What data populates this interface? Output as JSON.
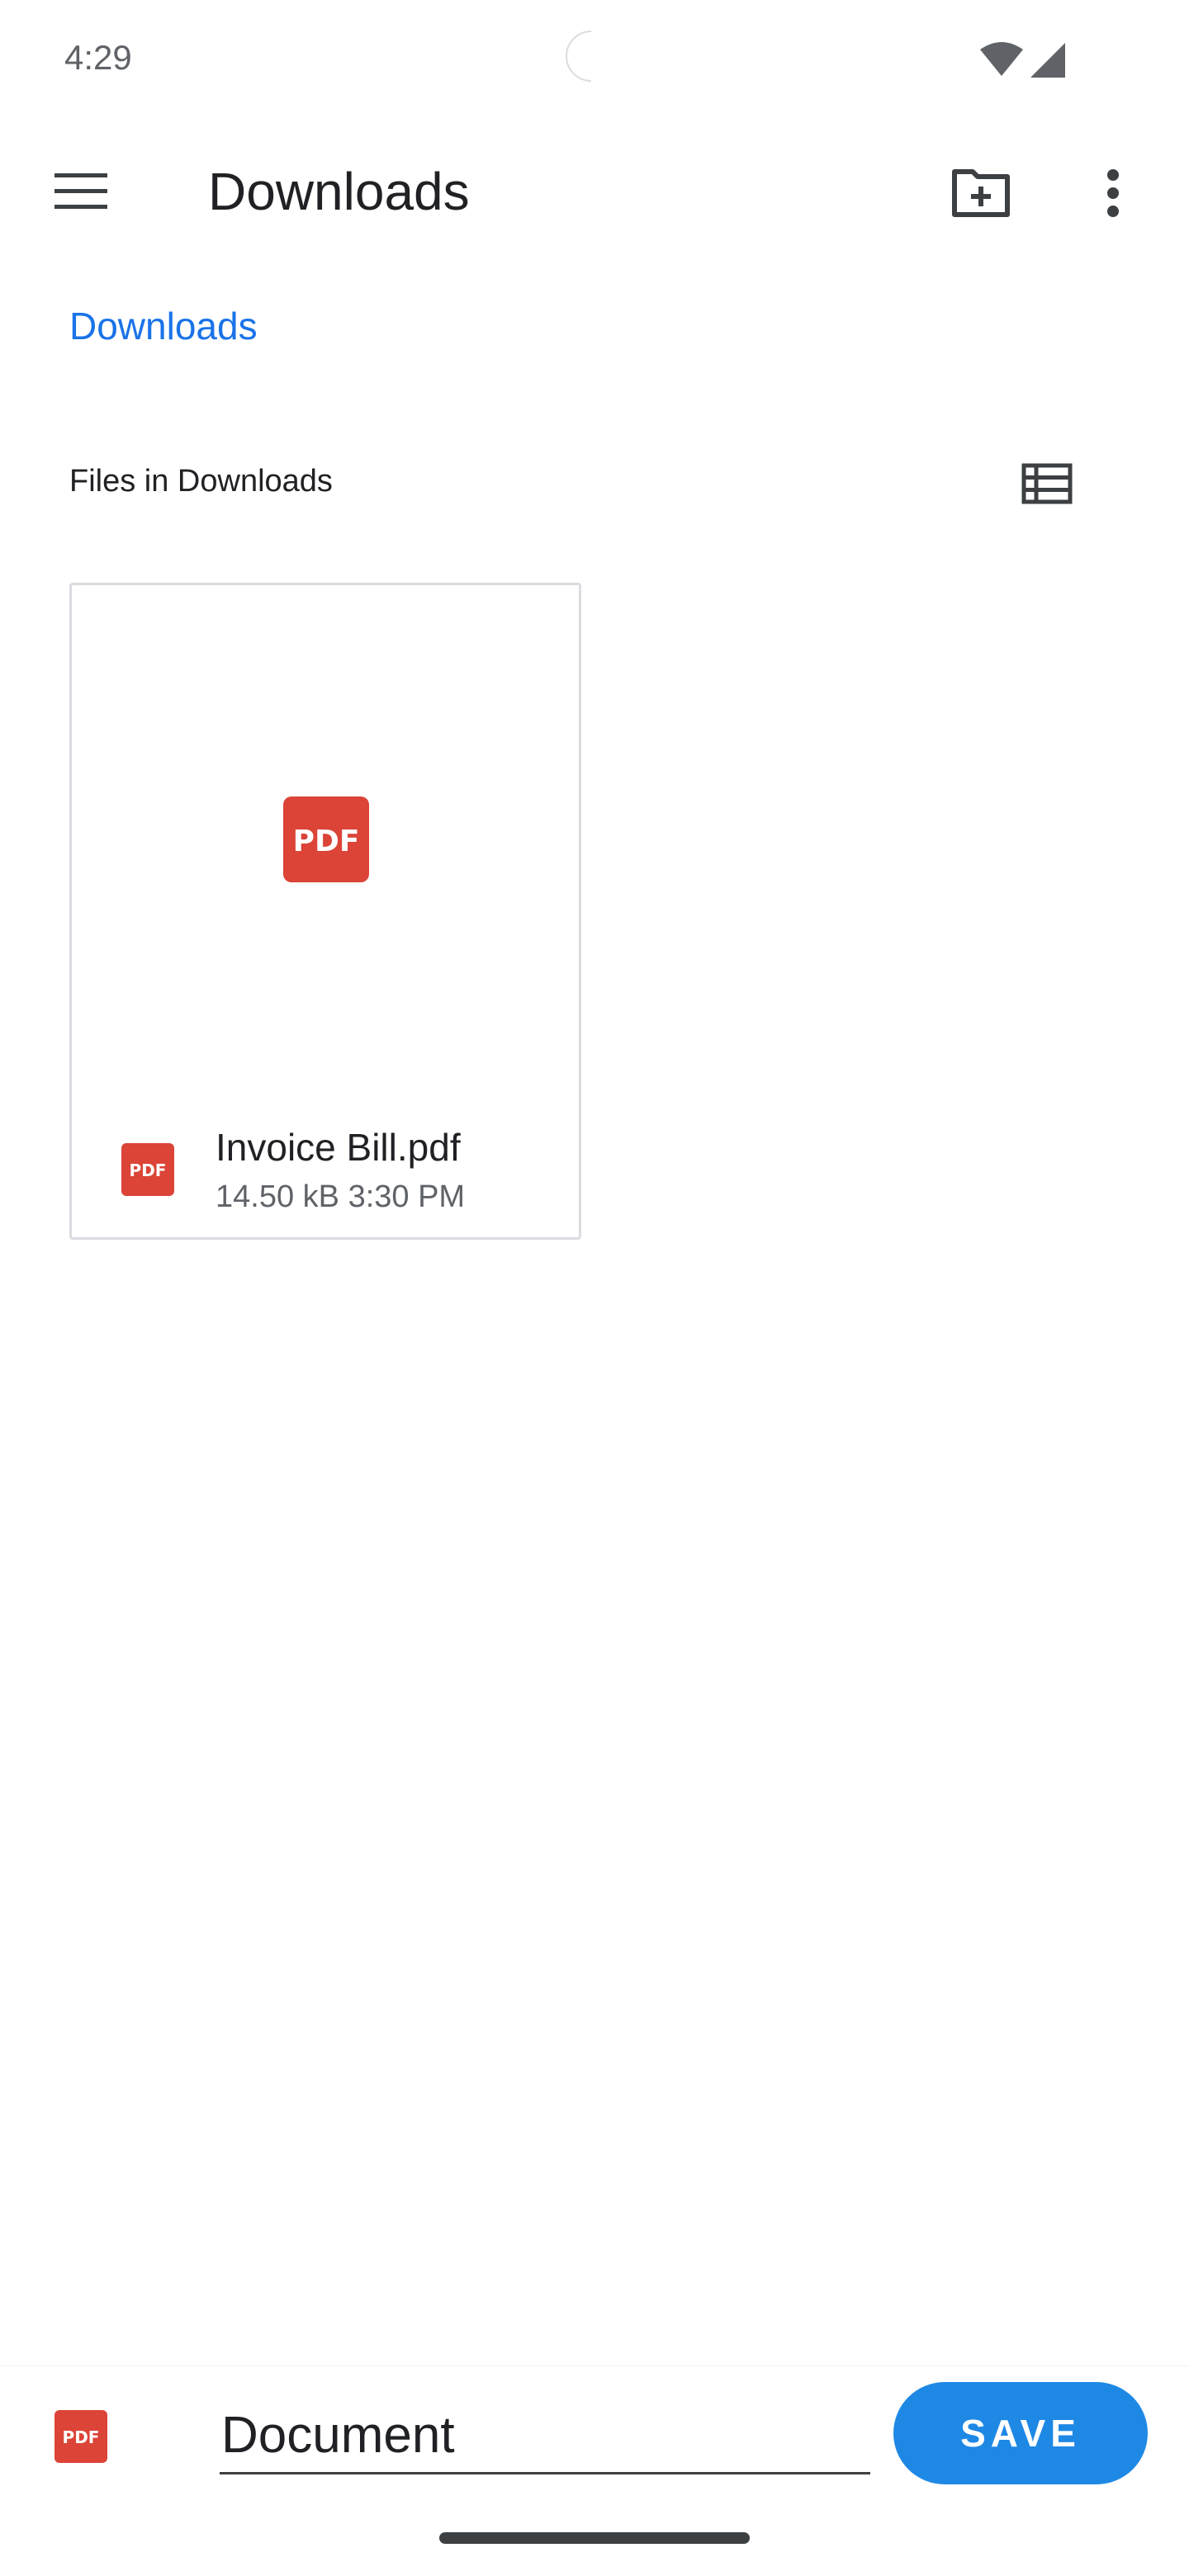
{
  "status_bar": {
    "time": "4:29",
    "icons": [
      "camera-cutout",
      "wifi-icon",
      "cellular-signal-icon"
    ]
  },
  "toolbar": {
    "title": "Downloads",
    "icons": [
      "hamburger-menu-icon",
      "new-folder-icon",
      "more-vert-icon"
    ]
  },
  "breadcrumb": {
    "label": "Downloads"
  },
  "files_section": {
    "title": "Files in Downloads",
    "view_toggle_icon": "list-view-icon"
  },
  "files": [
    {
      "name": "Invoice Bill.pdf",
      "size": "14.50 kB",
      "time": "3:30 PM",
      "type_icon": "pdf-icon"
    }
  ],
  "save_bar": {
    "filename_value": "Document",
    "save_label": "SAVE",
    "type_icon": "pdf-icon"
  },
  "colors": {
    "accent": "#1a73e8",
    "save_button": "#1e88e5",
    "pdf_red": "#db4437"
  }
}
